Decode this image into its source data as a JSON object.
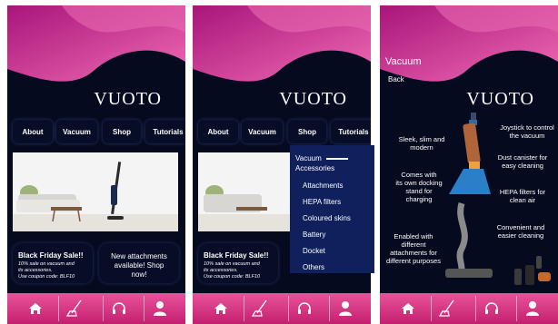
{
  "brand": "VUOTO",
  "nav": {
    "about": "About",
    "vacuum": "Vacuum",
    "shop": "Shop",
    "tutorials": "Tutorials"
  },
  "cards": {
    "sale_title": "Black Friday Sale!!",
    "sale_line1": "10% sale on vacuum and",
    "sale_line2": "its accessories.",
    "sale_line3": "Use coupon code: BLF10",
    "sale_line3_b": "Use coupon code: BLF10",
    "attach_line1": "New attachments",
    "attach_line2": "available! Shop",
    "attach_line3": "now!"
  },
  "dropdown": {
    "vacuum": "Vacuum",
    "accessories": "Accessories",
    "items": [
      "Attachments",
      "HEPA filters",
      "Coloured skins",
      "Battery",
      "Docket",
      "Others"
    ]
  },
  "detail": {
    "title": "Vacuum",
    "back": "Back",
    "features_left": [
      [
        "Sleek, slim and",
        "modern"
      ],
      [
        "Comes with",
        "its own docking",
        "stand for",
        "charging"
      ],
      [
        "Enabled with",
        "different",
        "attachments for",
        "different purposes"
      ]
    ],
    "features_right": [
      [
        "Joystick to control",
        "the vacuum"
      ],
      [
        "Dust canister for",
        "easy cleaning"
      ],
      [
        "HEPA filters for",
        "clean air"
      ],
      [
        "Convenient and",
        "easier cleaning"
      ]
    ]
  },
  "tabs": [
    "home-icon",
    "vacuum-icon",
    "headset-icon",
    "profile-icon"
  ],
  "colors": {
    "background": "#050a1e",
    "pink": "#e0449a",
    "magenta": "#c41f70",
    "dropdown": "#0f205c"
  }
}
